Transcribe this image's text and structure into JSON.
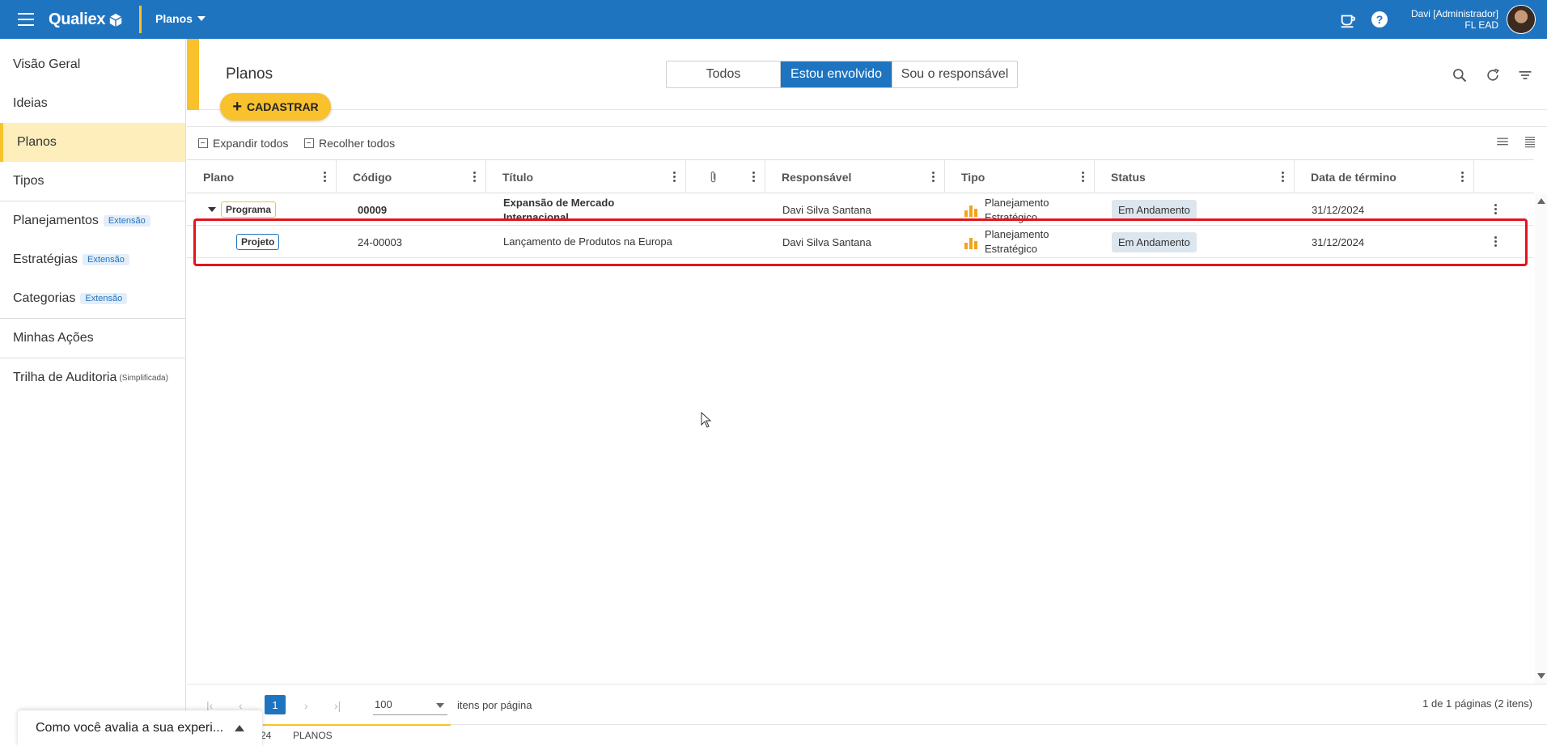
{
  "topbar": {
    "brand": "Qualiex",
    "module": "Planos",
    "user_name": "Davi [Administrador]",
    "user_org": "FL EAD"
  },
  "sidebar": {
    "items": [
      {
        "label": "Visão Geral"
      },
      {
        "label": "Ideias"
      },
      {
        "label": "Planos"
      },
      {
        "label": "Tipos"
      },
      {
        "label": "Planejamentos",
        "badge": "Extensão"
      },
      {
        "label": "Estratégias",
        "badge": "Extensão"
      },
      {
        "label": "Categorias",
        "badge": "Extensão"
      },
      {
        "label": "Minhas Ações"
      },
      {
        "label": "Trilha de Auditoria",
        "note": "(Simplificada)"
      }
    ]
  },
  "header": {
    "title": "Planos",
    "cadastrar": "CADASTRAR",
    "filters": [
      "Todos",
      "Estou envolvido",
      "Sou o responsável"
    ]
  },
  "toolbar": {
    "expand": "Expandir todos",
    "collapse": "Recolher todos"
  },
  "grid": {
    "columns": [
      "Plano",
      "Código",
      "Título",
      "",
      "Responsável",
      "Tipo",
      "Status",
      "Data de término"
    ],
    "rows": [
      {
        "plano": "Programa",
        "codigo": "00009",
        "titulo": "Expansão de Mercado Internacional",
        "responsavel": "Davi Silva Santana",
        "tipo": "Planejamento Estratégico",
        "status": "Em Andamento",
        "data": "31/12/2024"
      },
      {
        "plano": "Projeto",
        "codigo": "24-00003",
        "titulo": "Lançamento de Produtos na Europa",
        "responsavel": "Davi Silva Santana",
        "tipo": "Planejamento Estratégico",
        "status": "Em Andamento",
        "data": "31/12/2024"
      }
    ]
  },
  "pager": {
    "page": "1",
    "page_size": "100",
    "per_page_label": "itens por página",
    "summary": "1 de 1 páginas (2 itens)"
  },
  "bottom": {
    "tab_partial": "24",
    "tab_planos": "PLANOS"
  },
  "feedback": {
    "text": "Como você avalia a sua experi..."
  },
  "colors": {
    "primary": "#1f74c0",
    "accent": "#f9c12c",
    "highlight": "#e3141d"
  }
}
